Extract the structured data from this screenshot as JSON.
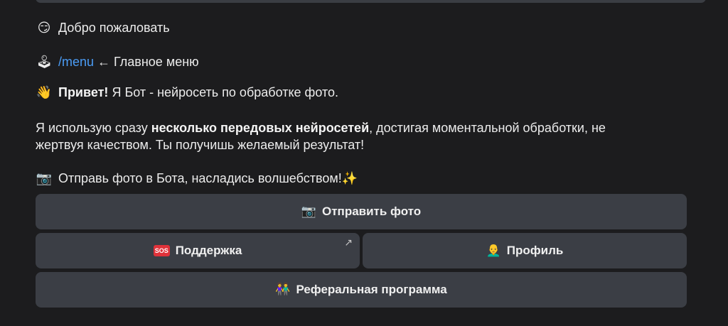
{
  "messages": {
    "welcome": {
      "icon": "😏",
      "text": "Добро пожаловать"
    },
    "menu": {
      "icon": "🕹",
      "command": "/menu",
      "rest": "← Главное меню"
    },
    "greeting": {
      "icon": "👋",
      "bold": "Привет!",
      "text": "Я Бот - нейросеть по обработке фото."
    },
    "description": {
      "pre": "Я использую сразу",
      "bold": "несколько передовых нейросетей",
      "post1": ", достигая моментальной обработки, не",
      "line2": "жертвуя качеством. Ты получишь желаемый результат!"
    },
    "send_prompt": {
      "icon": "📷",
      "text": "Отправь фото в Бота, насладись волшебством!",
      "sparkles": "✨"
    }
  },
  "keyboard": {
    "send_photo": {
      "icon": "📷",
      "label": "Отправить фото"
    },
    "support": {
      "icon": "SOS",
      "label": "Поддержка",
      "corner": "↗"
    },
    "profile": {
      "icon": "👨‍🦲",
      "label": "Профиль"
    },
    "referral": {
      "icon": "👫",
      "label": "Реферальная программа"
    }
  },
  "colors": {
    "background": "#1c1c1e",
    "button": "#3b3e45",
    "link": "#4b9cf5"
  }
}
